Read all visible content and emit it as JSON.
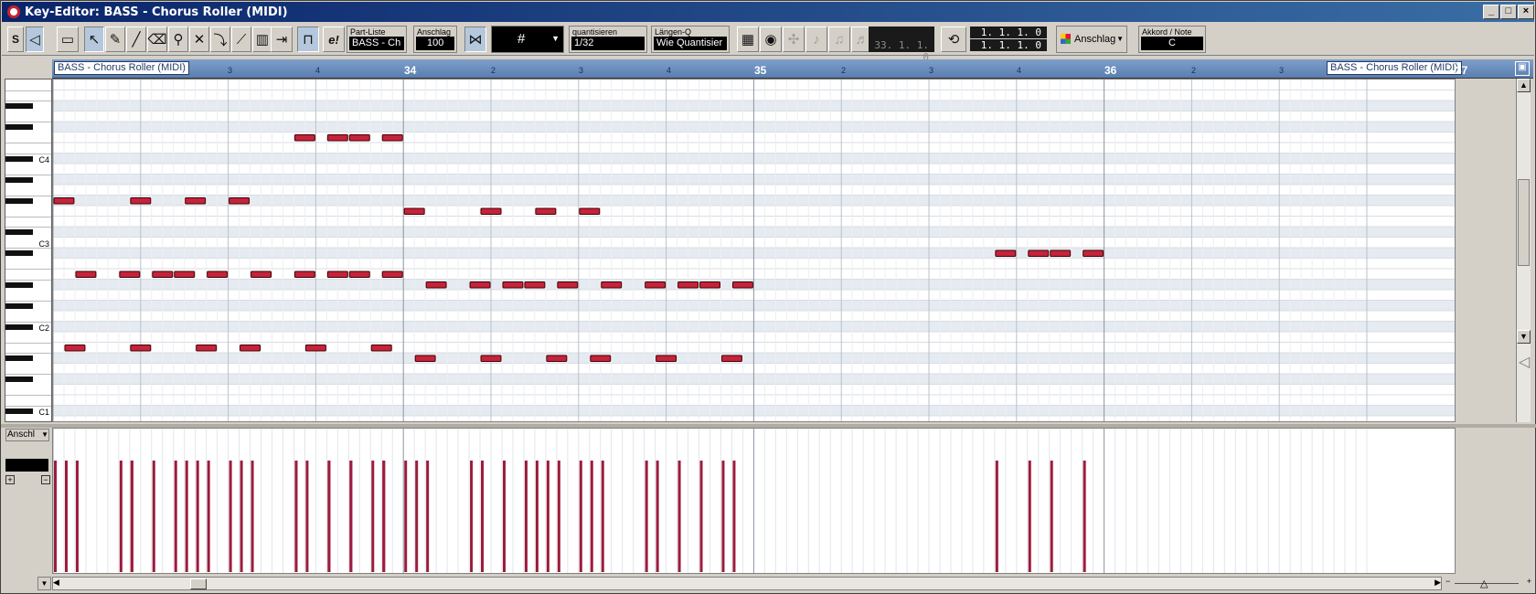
{
  "window": {
    "title": "Key-Editor: BASS - Chorus Roller (MIDI)"
  },
  "toolbar": {
    "part_list": {
      "label": "Part-Liste",
      "value": "BASS - Ch"
    },
    "velocity": {
      "label": "Anschlag",
      "value": "100"
    },
    "quantize": {
      "label": "quantisieren",
      "value": "1/32"
    },
    "length_q": {
      "label": "Längen-Q",
      "value": "Wie Quantisier"
    },
    "pos_left": "33. 1. 1.   0",
    "pos_right_top": "1. 1. 1.   0",
    "pos_right_bottom": "1. 1. 1.   0",
    "color_mode": "Anschlag",
    "chord": {
      "label": "Akkord / Note",
      "value": "C"
    }
  },
  "ruler": {
    "part_label": "BASS - Chorus Roller (MIDI)",
    "part_label_right": "BASS - Chorus Roller (MIDI)",
    "bars": [
      "34",
      "35",
      "36",
      "37"
    ],
    "beats": [
      "3",
      "4",
      "2",
      "3",
      "4",
      "2",
      "3",
      "4",
      "2",
      "3"
    ]
  },
  "keyboard": {
    "labels": [
      "C4",
      "C3",
      "C2",
      "C1"
    ]
  },
  "velocity_lane": {
    "selector": "Anschl"
  },
  "colors": {
    "note": "#c4233c",
    "velocity": "#9c1c3c",
    "ruler": "#6a8cbf"
  },
  "notes": [
    {
      "pitch": 60,
      "start": 0.25,
      "dur": 0.25
    },
    {
      "pitch": 60,
      "start": 1.0,
      "dur": 0.25
    },
    {
      "pitch": 60,
      "start": 1.75,
      "dur": 0.25
    },
    {
      "pitch": 60,
      "start": 2.25,
      "dur": 0.25
    },
    {
      "pitch": 49,
      "start": 0.0,
      "dur": 0.25
    },
    {
      "pitch": 49,
      "start": 0.5,
      "dur": 0.25
    },
    {
      "pitch": 49,
      "start": 1.0,
      "dur": 0.25
    },
    {
      "pitch": 49,
      "start": 1.5,
      "dur": 0.25
    },
    {
      "pitch": 41,
      "start": -1.25,
      "dur": 0.25
    },
    {
      "pitch": 41,
      "start": -0.5,
      "dur": 0.25
    },
    {
      "pitch": 41,
      "start": 0.25,
      "dur": 0.25
    },
    {
      "pitch": 41,
      "start": 1.0,
      "dur": 0.25
    },
    {
      "pitch": 40,
      "start": -0.75,
      "dur": 0.25
    },
    {
      "pitch": 40,
      "start": -0.25,
      "dur": 0.25
    },
    {
      "pitch": 40,
      "start": 0.25,
      "dur": 0.25
    },
    {
      "pitch": 40,
      "start": 0.5,
      "dur": 0.25
    },
    {
      "pitch": 40,
      "start": 0.75,
      "dur": 0.25
    },
    {
      "pitch": 40,
      "start": 1.25,
      "dur": 0.25
    },
    {
      "pitch": 34,
      "start": -0.25,
      "dur": 0.25
    },
    {
      "pitch": 34,
      "start": 0.75,
      "dur": 0.25
    },
    {
      "pitch": 34,
      "start": 1.75,
      "dur": 0.25
    },
    {
      "pitch": 34,
      "start": 2.0,
      "dur": 0.25
    }
  ],
  "notes_abs": [
    {
      "p": 60,
      "b": 2.75
    },
    {
      "p": 60,
      "b": 3.125
    },
    {
      "p": 60,
      "b": 3.375
    },
    {
      "p": 60,
      "b": 3.75
    },
    {
      "p": 49,
      "b": 10.75
    },
    {
      "p": 49,
      "b": 11.125
    },
    {
      "p": 49,
      "b": 11.375
    },
    {
      "p": 49,
      "b": 11.75
    },
    {
      "p": 54,
      "b": 0
    },
    {
      "p": 54,
      "b": 0.875
    },
    {
      "p": 54,
      "b": 1.5
    },
    {
      "p": 54,
      "b": 2.0
    },
    {
      "p": 53,
      "b": 4.0
    },
    {
      "p": 53,
      "b": 4.875
    },
    {
      "p": 53,
      "b": 5.5
    },
    {
      "p": 53,
      "b": 6.0
    },
    {
      "p": 47,
      "b": 0.25
    },
    {
      "p": 47,
      "b": 0.75
    },
    {
      "p": 47,
      "b": 1.125
    },
    {
      "p": 47,
      "b": 1.375
    },
    {
      "p": 47,
      "b": 1.75
    },
    {
      "p": 47,
      "b": 2.25
    },
    {
      "p": 47,
      "b": 2.75
    },
    {
      "p": 47,
      "b": 3.125
    },
    {
      "p": 47,
      "b": 3.375
    },
    {
      "p": 47,
      "b": 3.75
    },
    {
      "p": 46,
      "b": 4.25
    },
    {
      "p": 46,
      "b": 4.75
    },
    {
      "p": 46,
      "b": 5.125
    },
    {
      "p": 46,
      "b": 5.375
    },
    {
      "p": 46,
      "b": 5.75
    },
    {
      "p": 46,
      "b": 6.25
    },
    {
      "p": 46,
      "b": 6.75
    },
    {
      "p": 46,
      "b": 7.125
    },
    {
      "p": 46,
      "b": 7.375
    },
    {
      "p": 46,
      "b": 7.75
    },
    {
      "p": 40,
      "b": 0.125
    },
    {
      "p": 40,
      "b": 0.875
    },
    {
      "p": 40,
      "b": 1.625
    },
    {
      "p": 40,
      "b": 2.125
    },
    {
      "p": 40,
      "b": 2.875
    },
    {
      "p": 40,
      "b": 3.625
    },
    {
      "p": 39,
      "b": 4.125
    },
    {
      "p": 39,
      "b": 4.875
    },
    {
      "p": 39,
      "b": 5.625
    },
    {
      "p": 39,
      "b": 6.125
    },
    {
      "p": 39,
      "b": 6.875
    },
    {
      "p": 39,
      "b": 7.625
    }
  ]
}
